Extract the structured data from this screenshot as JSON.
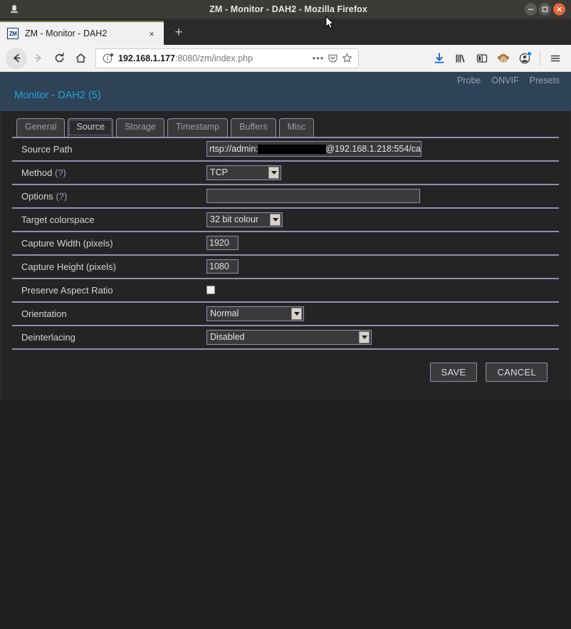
{
  "window": {
    "title": "ZM - Monitor - DAH2 - Mozilla Firefox",
    "app_icon": "firefox-window-icon",
    "minimize": "–",
    "maximize": "□",
    "close": "×"
  },
  "browser": {
    "tab": {
      "favicon_text": "ZM",
      "title": "ZM - Monitor - DAH2",
      "close_label": "×"
    },
    "new_tab_label": "+",
    "nav": {
      "back": "←",
      "forward": "→",
      "reload": "⟳",
      "home": "⌂"
    },
    "url": {
      "host": "192.168.1.177",
      "path": ":8080/zm/index.php",
      "page_actions": "•••",
      "pocket": "pocket-icon",
      "bookmark": "☆"
    },
    "toolbar_icons": [
      {
        "name": "downloads-icon",
        "glyph": "⬇"
      },
      {
        "name": "library-icon",
        "glyph": "library"
      },
      {
        "name": "sidebar-icon",
        "glyph": "sidebar"
      },
      {
        "name": "monkey-extension-icon",
        "glyph": "monkey"
      },
      {
        "name": "account-icon",
        "glyph": "account"
      },
      {
        "name": "app-menu-icon",
        "glyph": "☰"
      }
    ]
  },
  "zm": {
    "top_links": [
      "Probe",
      "ONVIF",
      "Presets"
    ],
    "page_title": "Monitor - DAH2 (5)",
    "tabs": [
      {
        "label": "General",
        "active": false
      },
      {
        "label": "Source",
        "active": true
      },
      {
        "label": "Storage",
        "active": false
      },
      {
        "label": "Timestamp",
        "active": false
      },
      {
        "label": "Buffers",
        "active": false
      },
      {
        "label": "Misc",
        "active": false
      }
    ],
    "fields": {
      "source_path": {
        "label": "Source Path",
        "value_prefix": "rtsp://admin:",
        "value_suffix": "@192.168.1.218:554/ca",
        "redacted": true
      },
      "method": {
        "label": "Method",
        "help": "(?)",
        "value": "TCP"
      },
      "options": {
        "label": "Options",
        "help": "(?)",
        "value": "",
        "placeholder": ""
      },
      "target_colorspace": {
        "label": "Target colorspace",
        "value": "32 bit colour"
      },
      "capture_width": {
        "label": "Capture Width (pixels)",
        "value": "1920"
      },
      "capture_height": {
        "label": "Capture Height (pixels)",
        "value": "1080"
      },
      "preserve_aspect_ratio": {
        "label": "Preserve Aspect Ratio",
        "checked": false
      },
      "orientation": {
        "label": "Orientation",
        "value": "Normal"
      },
      "deinterlacing": {
        "label": "Deinterlacing",
        "value": "Disabled"
      }
    },
    "buttons": {
      "save": "SAVE",
      "cancel": "CANCEL"
    }
  },
  "colors": {
    "zm_header_bg": "#2e4258",
    "zm_title": "#22a3d1",
    "zm_border": "#8f8fb0",
    "page_bg": "#242424",
    "titlebar_bg": "#3c3b37",
    "close_button": "#e8663c",
    "tab_accent": "#6b7f3e",
    "download_icon": "#0a5fd0"
  }
}
